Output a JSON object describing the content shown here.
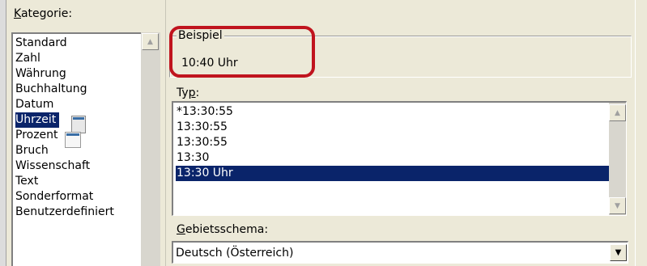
{
  "category": {
    "label": "Kategorie:",
    "items": [
      "Standard",
      "Zahl",
      "Währung",
      "Buchhaltung",
      "Datum",
      "Uhrzeit",
      "Prozent",
      "Bruch",
      "Wissenschaft",
      "Text",
      "Sonderformat",
      "Benutzerdefiniert"
    ],
    "selected": "Uhrzeit"
  },
  "sample": {
    "label": "Beispiel",
    "value": "10:40 Uhr",
    "highlight_color": "#c0141e"
  },
  "type": {
    "label": "Typ:",
    "items": [
      "*13:30:55",
      "13:30:55",
      "13:30:55",
      "13:30",
      "13:30 Uhr"
    ],
    "selected": "13:30 Uhr"
  },
  "locale": {
    "label": "Gebietsschema:",
    "value": "Deutsch (Österreich)"
  },
  "icons": {
    "scroll_up": "▲",
    "scroll_down": "▼",
    "dropdown": "▼"
  },
  "colors": {
    "selection": "#0a246a",
    "window": "#ece9d8"
  }
}
